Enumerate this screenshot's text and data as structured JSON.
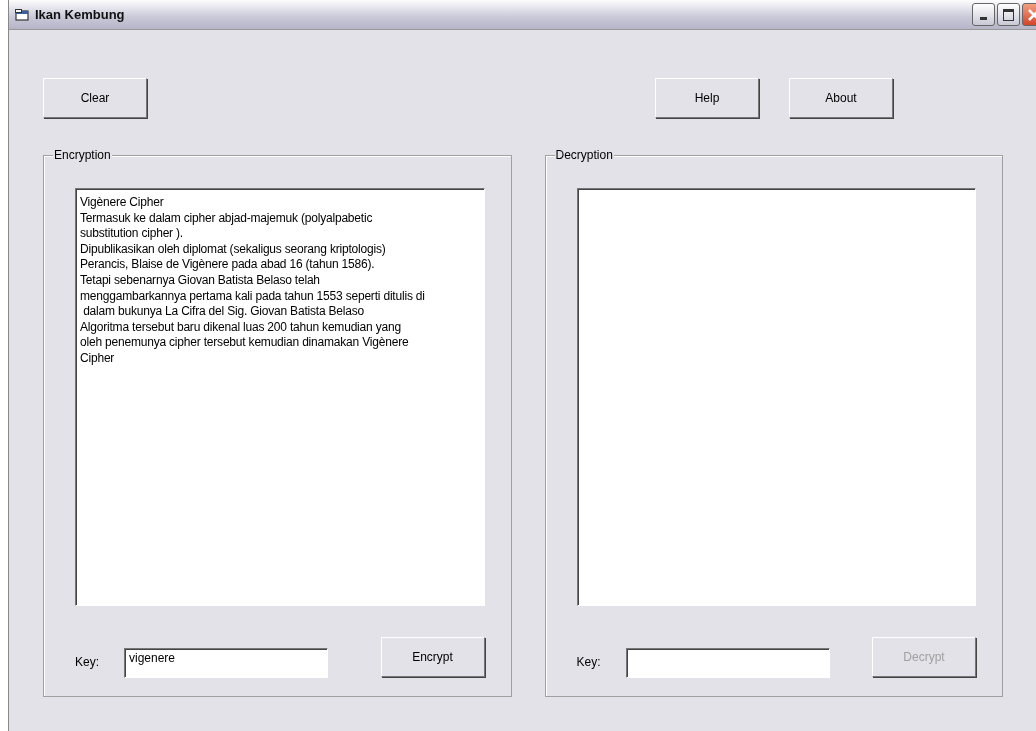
{
  "window": {
    "title": "Ikan Kembung"
  },
  "toolbar": [
    {
      "label": "Clear",
      "kind": "left"
    },
    {
      "label": "Help",
      "kind": "right"
    },
    {
      "label": "About",
      "kind": "right"
    }
  ],
  "panels": [
    {
      "title": "Encryption",
      "text": "Vigènere Cipher\nTermasuk ke dalam cipher abjad-majemuk (polyalpabetic\nsubstitution cipher ).\nDipublikasikan oleh diplomat (sekaligus seorang kriptologis)\nPerancis, Blaise de Vigènere pada abad 16 (tahun 1586).\nTetapi sebenarnya Giovan Batista Belaso telah\nmenggambarkannya pertama kali pada tahun 1553 seperti ditulis di\n dalam bukunya La Cifra del Sig. Giovan Batista Belaso\nAlgoritma tersebut baru dikenal luas 200 tahun kemudian yang\noleh penemunya cipher tersebut kemudian dinamakan Vigènere\nCipher",
      "key_label": "Key:",
      "key_value": "vigenere",
      "button": {
        "label": "Encrypt",
        "disabled": false
      }
    },
    {
      "title": "Decryption",
      "key_label": "Key:",
      "button": {
        "label": "Decrypt",
        "disabled": true
      }
    }
  ]
}
